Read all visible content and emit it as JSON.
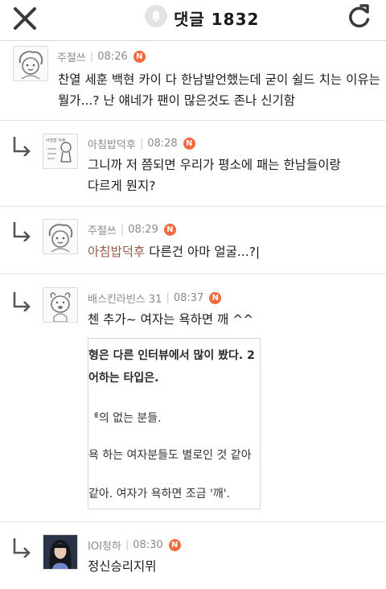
{
  "header": {
    "title": "댓글 1832",
    "close_icon": "close-icon",
    "bell_icon": "bell-icon",
    "refresh_icon": "refresh-icon"
  },
  "comments": [
    {
      "author": "주절쓰",
      "time": "08:26",
      "badge": "N",
      "avatar_icon": "doodle-avatar",
      "lines": [
        "찬열 세훈 백현 카이 다 한남발언했는데 굳이 쉴드 치는 이유는",
        "뭘가...? 난 얘네가 팬이 많은것도 존나 신기함"
      ]
    },
    {
      "author": "아침밥덕후",
      "time": "08:28",
      "badge": "N",
      "avatar_icon": "sketch-avatar",
      "lines": [
        "그니까 저 쯤되면 우리가 평소에 패는 한남들이랑",
        "다르게 뭔지?"
      ]
    },
    {
      "author": "주절쓰",
      "time": "08:29",
      "badge": "N",
      "avatar_icon": "doodle-avatar",
      "mention": "아침밥덕후",
      "text": " 다른건 아마 얼굴...?|"
    },
    {
      "author": "배스킨라빈스 31",
      "time": "08:37",
      "badge": "N",
      "avatar_icon": "dog-avatar",
      "text": "첸 추가~ 여자는 욕하면 깨 ^^",
      "quote_lines": [
        "형은 다른 인터뷰에서 많이 봤다. 2",
        "어하는 타입은.",
        "ᅨ의 없는 분들.",
        "욕 하는 여자분들도 별로인 것 같아",
        "같아. 여자가 욕하면 조금 '깨'."
      ]
    },
    {
      "author": "IOI청하",
      "time": "08:30",
      "badge": "N",
      "avatar_icon": "photo-avatar",
      "text": "정신승리지뮈"
    }
  ],
  "colors": {
    "badge": "#f06a3e",
    "mention": "#9c5a48",
    "meta": "#8a8a8a",
    "divider": "#e2e2e2"
  }
}
